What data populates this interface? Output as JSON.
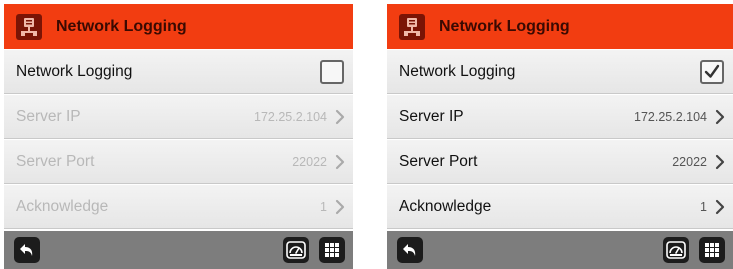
{
  "screens": [
    {
      "title": "Network Logging",
      "logging_checked": false,
      "rows": [
        {
          "label": "Network Logging"
        },
        {
          "label": "Server IP",
          "value": "172.25.2.104"
        },
        {
          "label": "Server Port",
          "value": "22022"
        },
        {
          "label": "Acknowledge",
          "value": "1"
        }
      ]
    },
    {
      "title": "Network Logging",
      "logging_checked": true,
      "rows": [
        {
          "label": "Network Logging"
        },
        {
          "label": "Server IP",
          "value": "172.25.2.104"
        },
        {
          "label": "Server Port",
          "value": "22022"
        },
        {
          "label": "Acknowledge",
          "value": "1"
        }
      ]
    }
  ],
  "colors": {
    "header": "#f23d11",
    "footer": "#7d7d7d",
    "row": "#eeeeee"
  },
  "icons": [
    "network-app-icon",
    "checkbox",
    "chevron-right-icon",
    "back-icon",
    "gauge-icon",
    "grid-menu-icon"
  ]
}
